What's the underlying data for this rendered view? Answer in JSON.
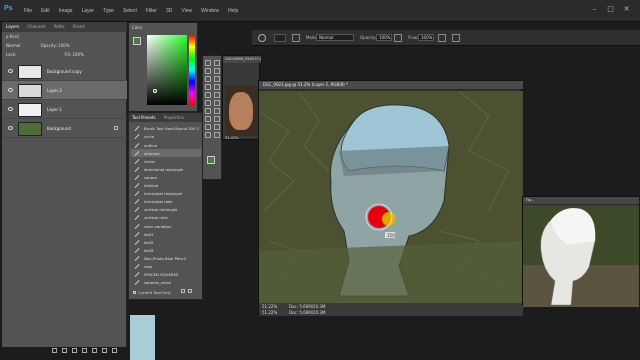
{
  "menubar": {
    "logo": "Ps",
    "items": [
      "File",
      "Edit",
      "Image",
      "Layer",
      "Type",
      "Select",
      "Filter",
      "3D",
      "View",
      "Window",
      "Help"
    ]
  },
  "window_controls": {
    "minimize": "–",
    "maximize": "□",
    "close": "✕"
  },
  "layers_panel": {
    "tabs": [
      "Layers",
      "Channels",
      "Paths",
      "Smart"
    ],
    "kind_label": "ρ Kind",
    "blend_mode": "Normal",
    "opacity_label": "Opacity:",
    "opacity_value": "100%",
    "lock_label": "Lock:",
    "fill_label": "Fill:",
    "fill_value": "100%",
    "layers": [
      {
        "name": "Background copy",
        "selected": false
      },
      {
        "name": "Layer 2",
        "selected": true
      },
      {
        "name": "Layer 1",
        "selected": false
      },
      {
        "name": "Background",
        "selected": false
      }
    ]
  },
  "color_panel": {
    "title": "Color"
  },
  "tool_presets": {
    "tabs": [
      "Tool Presets",
      "Properties"
    ],
    "items": [
      "Brush Tool Hard Round 200 1",
      "circle",
      "outline",
      "airbrush",
      "chisel",
      "directional rectangle",
      "square",
      "thinline",
      "horizontal rectangle",
      "horizontal rake",
      "vertical rectangle",
      "vertical rake",
      "color variation",
      "leaf1",
      "leaf2",
      "leaf3",
      "Non-Photo Blue Pencil",
      "rads",
      "SPACED SQUARES",
      "squares_small"
    ],
    "selected_index": 3,
    "current_tool_only_label": "Current Tool Only"
  },
  "options_bar": {
    "mode_label": "Mode:",
    "mode_value": "Normal",
    "opacity_label": "Opacity:",
    "opacity_value": "100%",
    "flow_label": "Flow:",
    "flow_value": "100%"
  },
  "small_window": {
    "title": "DSC06906_RE0037.jpg @ 44%",
    "zoom": "31.43%"
  },
  "document": {
    "title": "DSC_0023.jpg @ 51.2% (Layer 2, RGB/8) *",
    "zoom": "51.22%",
    "doc_size": "Doc: 5.66M/20.3M",
    "tooltip": "150"
  },
  "photo_window": {
    "title": "Fig..."
  }
}
